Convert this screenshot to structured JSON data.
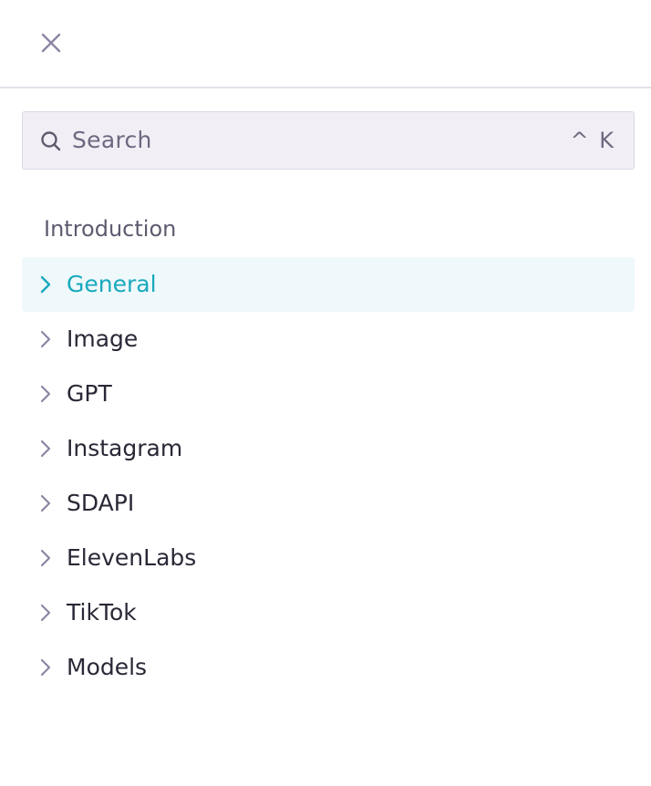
{
  "header": {
    "close_icon": "close-icon"
  },
  "search": {
    "label": "Search",
    "shortcut": "^ K",
    "icon": "search-icon"
  },
  "sidebar": {
    "section_title": "Introduction",
    "items": [
      {
        "label": "General",
        "active": true
      },
      {
        "label": "Image",
        "active": false
      },
      {
        "label": "GPT",
        "active": false
      },
      {
        "label": "Instagram",
        "active": false
      },
      {
        "label": "SDAPI",
        "active": false
      },
      {
        "label": "ElevenLabs",
        "active": false
      },
      {
        "label": "TikTok",
        "active": false
      },
      {
        "label": "Models",
        "active": false
      }
    ]
  },
  "colors": {
    "accent": "#18a9bd",
    "active_bg": "#eff8fa",
    "icon_muted": "#8e84a3",
    "text": "#2a2836"
  }
}
